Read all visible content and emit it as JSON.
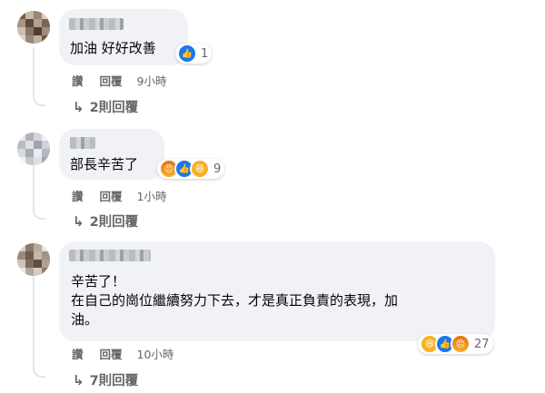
{
  "colors": {
    "bubble": "#f0f2f5",
    "meta_text": "#65676b",
    "like_blue": "#1877f2",
    "angry_orange": "#e9710f",
    "haha_yellow": "#f7b125"
  },
  "comments": [
    {
      "text": "加油 好好改善",
      "reactions": [
        "like-icon"
      ],
      "reaction_count": "1",
      "like_label": "讚",
      "reply_label": "回覆",
      "time": "9小時",
      "replies_link": "2則回覆"
    },
    {
      "text": "部長辛苦了",
      "reactions": [
        "angry-icon",
        "like-icon",
        "haha-icon"
      ],
      "reaction_count": "9",
      "like_label": "讚",
      "reply_label": "回覆",
      "time": "1小時",
      "replies_link": "2則回覆"
    },
    {
      "text_lines": [
        "辛苦了！",
        "在自己的崗位繼續努力下去，才是真正負責的表現，加",
        "油。"
      ],
      "reactions": [
        "haha-icon",
        "like-icon",
        "angry-icon"
      ],
      "reaction_count": "27",
      "like_label": "讚",
      "reply_label": "回覆",
      "time": "10小時",
      "replies_link": "7則回覆"
    }
  ]
}
